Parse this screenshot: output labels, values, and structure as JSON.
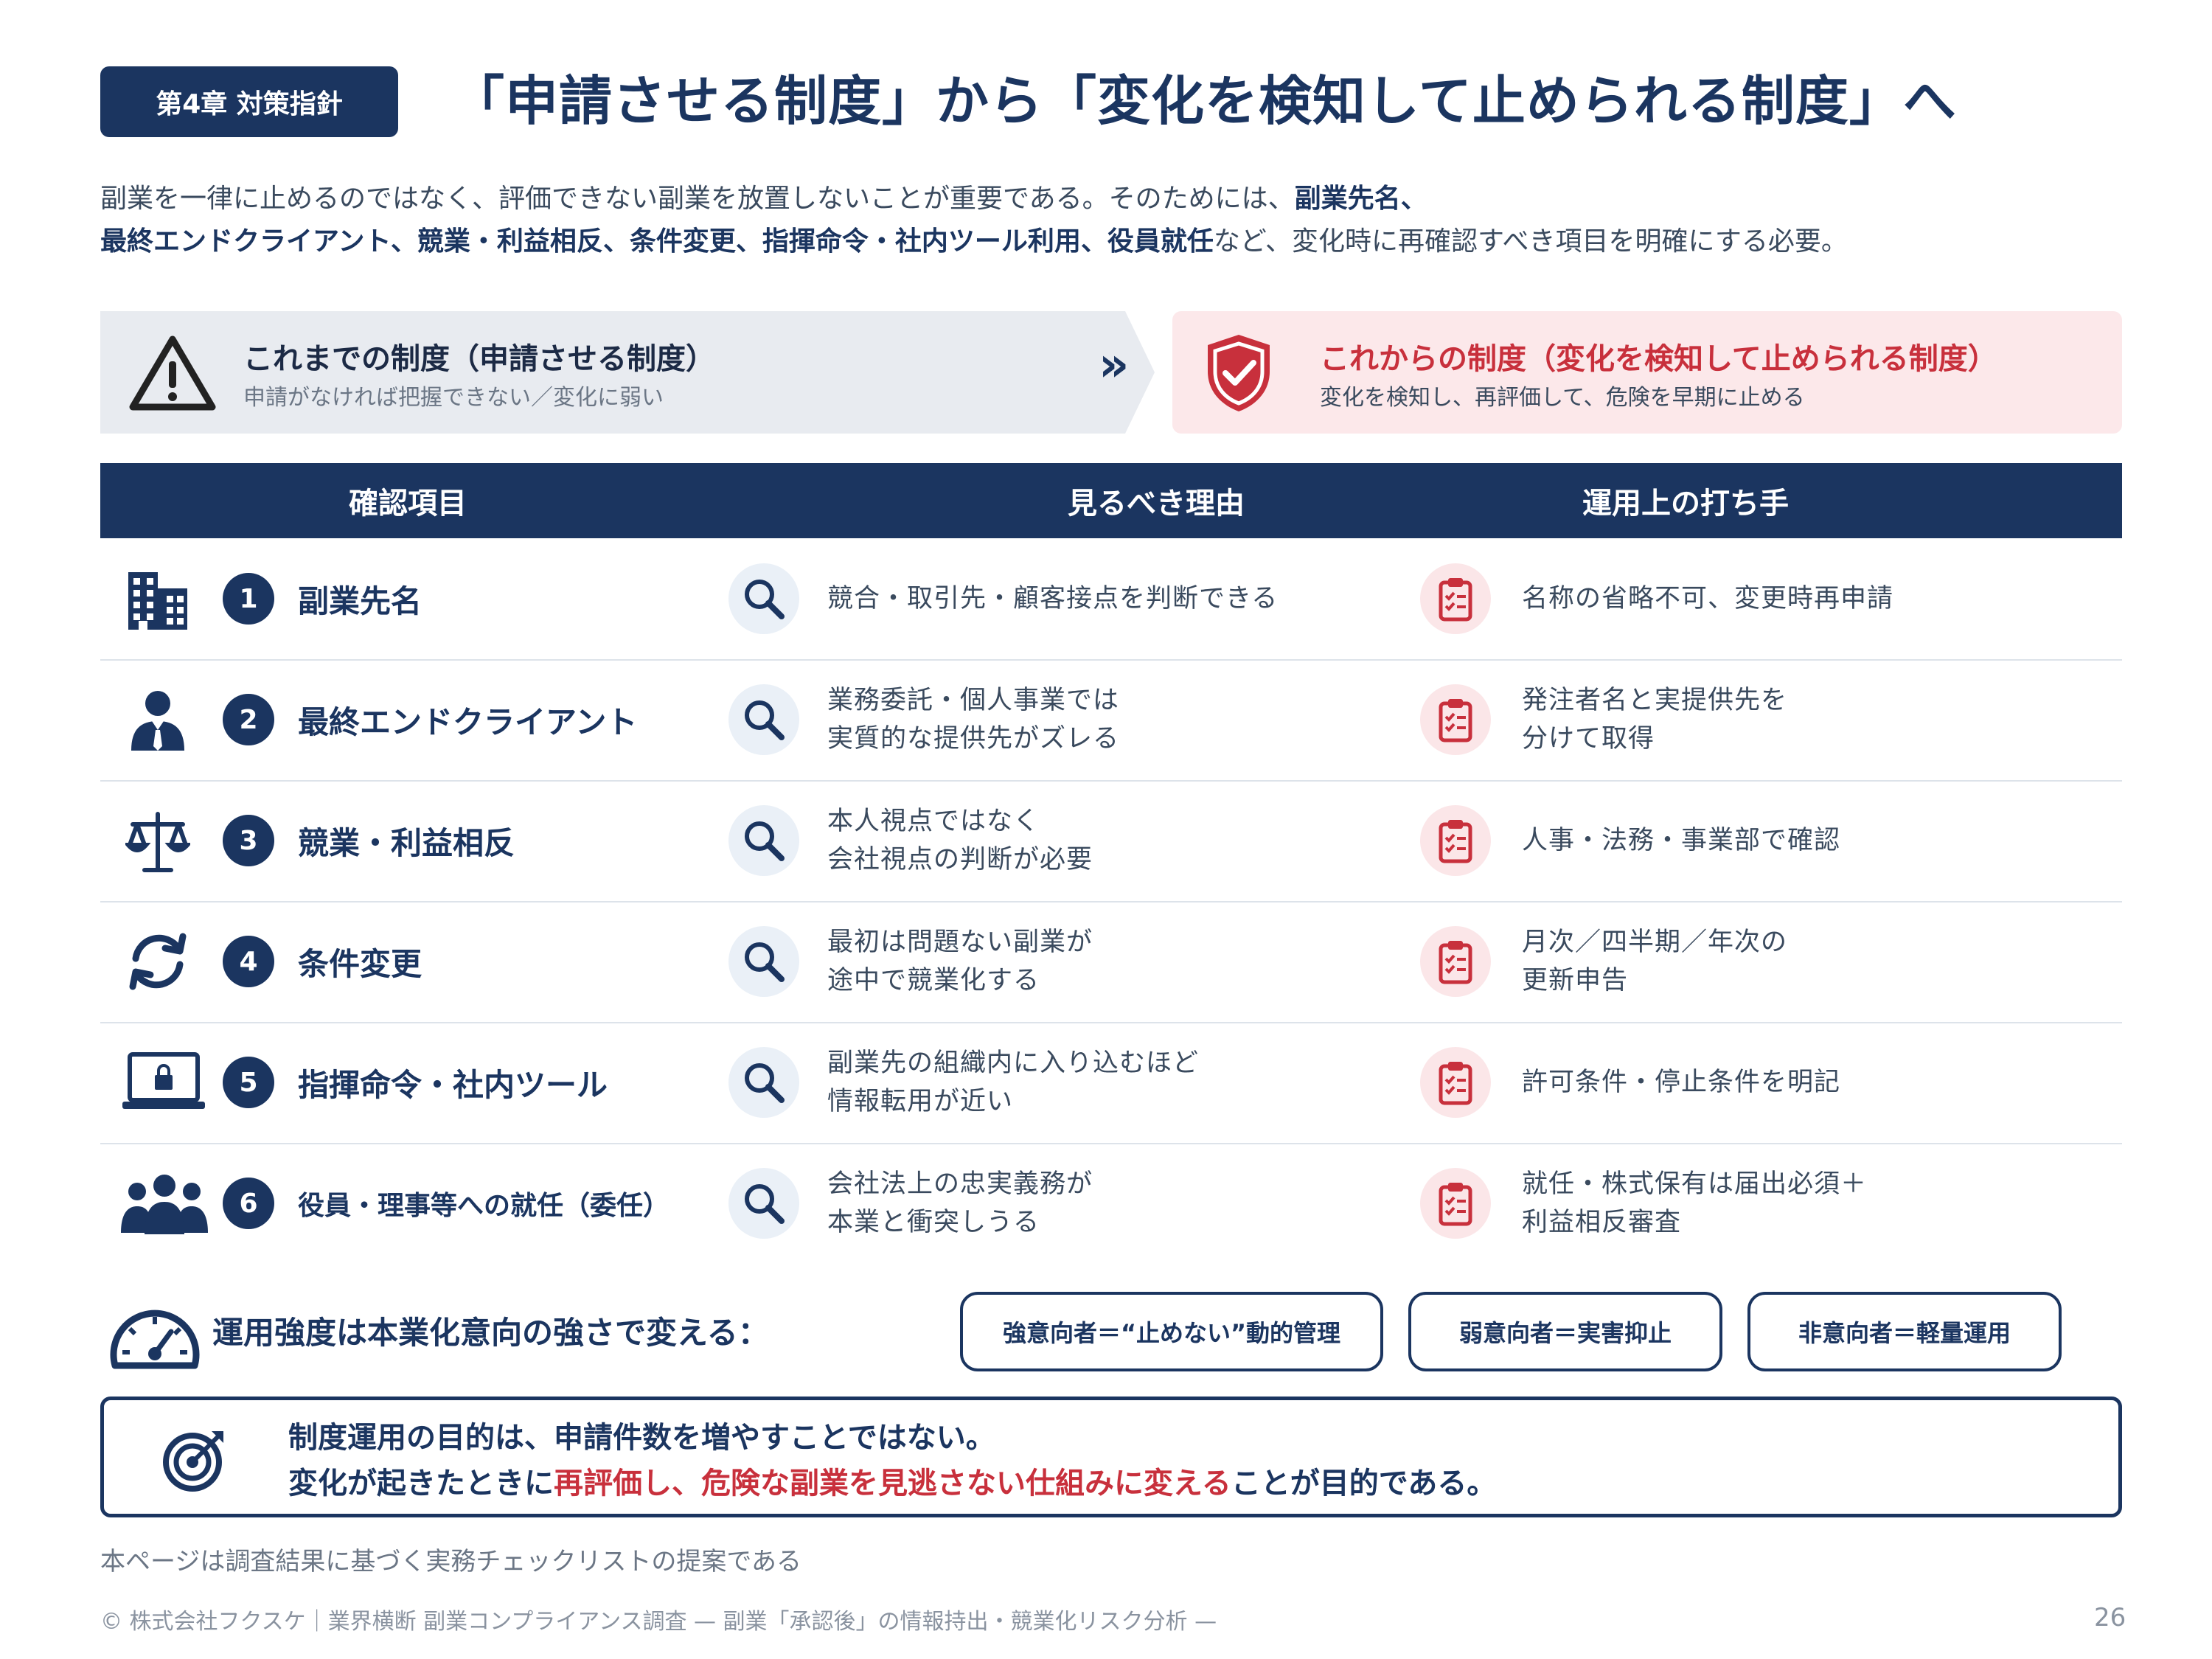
{
  "header": {
    "chapter_badge": "第4章 対策指針",
    "title": "「申請させる制度」から「変化を検知して止められる制度」へ"
  },
  "lead": {
    "line1_a": "副業を一律に止めるのではなく、評価できない副業を放置しないことが重要である。そのためには、",
    "line1_b": "副業先名、",
    "line2_a": "最終エンドクライアント、競業・利益相反、条件変更、指揮命令・社内ツール利用、役員就任",
    "line2_b": "など、変化時に再確認すべき項目を明確にする必要。"
  },
  "comparison": {
    "old_title": "これまでの制度（申請させる制度）",
    "old_sub": "申請がなければ把握できない／変化に弱い",
    "arrow": "»",
    "new_title": "これからの制度（変化を検知して止められる制度）",
    "new_sub": "変化を検知し、再評価して、危険を早期に止める"
  },
  "table": {
    "headers": [
      "確認項目",
      "見るべき理由",
      "運用上の打ち手"
    ],
    "rows": [
      {
        "num": "1",
        "item": "副業先名",
        "icon": "building-icon",
        "reason": [
          "競合・取引先・顧客接点を判断できる"
        ],
        "action": [
          "名称の省略不可、変更時再申請"
        ]
      },
      {
        "num": "2",
        "item": "最終エンドクライアント",
        "icon": "person-icon",
        "reason": [
          "業務委託・個人事業では",
          "実質的な提供先がズレる"
        ],
        "action": [
          "発注者名と実提供先を",
          "分けて取得"
        ]
      },
      {
        "num": "3",
        "item": "競業・利益相反",
        "icon": "scales-icon",
        "reason": [
          "本人視点ではなく",
          "会社視点の判断が必要"
        ],
        "action": [
          "人事・法務・事業部で確認"
        ]
      },
      {
        "num": "4",
        "item": "条件変更",
        "icon": "refresh-icon",
        "reason": [
          "最初は問題ない副業が",
          "途中で競業化する"
        ],
        "action": [
          "月次／四半期／年次の",
          "更新申告"
        ]
      },
      {
        "num": "5",
        "item": "指揮命令・社内ツール",
        "icon": "laptop-lock-icon",
        "reason": [
          "副業先の組織内に入り込むほど",
          "情報転用が近い"
        ],
        "action": [
          "許可条件・停止条件を明記"
        ]
      },
      {
        "num": "6",
        "item": "役員・理事等への就任（委任）",
        "icon": "group-icon",
        "reason": [
          "会社法上の忠実義務が",
          "本業と衝突しうる"
        ],
        "action": [
          "就任・株式保有は届出必須＋",
          "利益相反審査"
        ]
      }
    ]
  },
  "intensity": {
    "label": "運用強度は本業化意向の強さで変える：",
    "pills": [
      "強意向者＝“止めない”動的管理",
      "弱意向者＝実害抑止",
      "非意向者＝軽量運用"
    ]
  },
  "conclusion": {
    "line1": "制度運用の目的は、申請件数を増やすことではない。",
    "line2_a": "変化が起きたときに",
    "line2_b": "再評価し、危険な副業を見逃さない仕組みに変える",
    "line2_c": "ことが目的である。"
  },
  "note": "本ページは調査結果に基づく実務チェックリストの提案である",
  "footer": {
    "text": "© 株式会社フクスケ｜業界横断 副業コンプライアンス調査 — 副業「承認後」の情報持出・競業化リスク分析 —",
    "page": "26"
  },
  "colors": {
    "navy": "#1b3560",
    "red": "#c8303c",
    "pink_bg": "#fce8ea",
    "gray_bg": "#e8ebf0"
  }
}
